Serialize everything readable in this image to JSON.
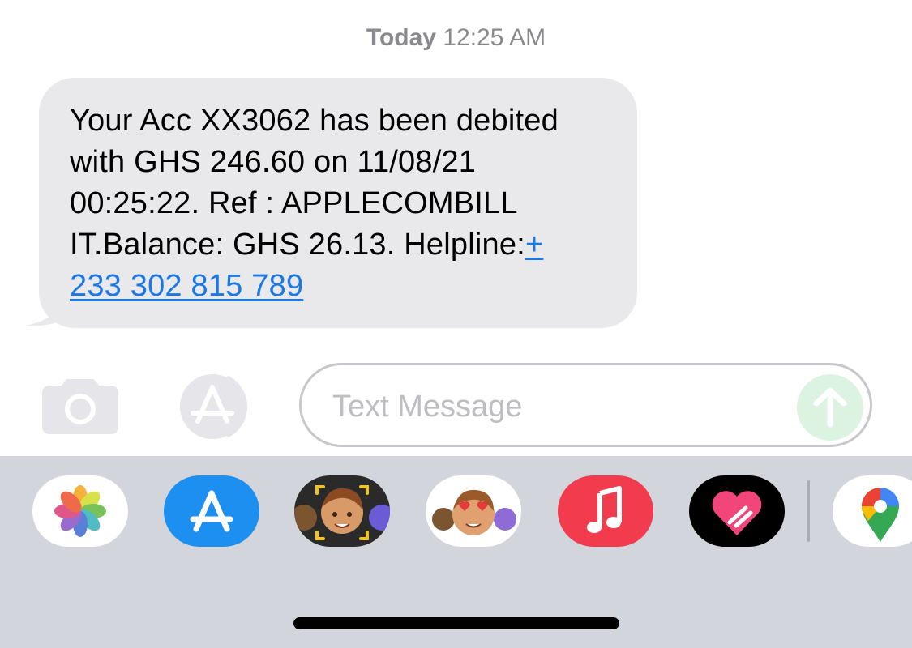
{
  "timestamp": {
    "day": "Today",
    "time": "12:25 AM"
  },
  "message": {
    "line1": "Your Acc XX3062 has been debited",
    "line2": "with GHS 246.60 on 11/08/21",
    "line3": "00:25:22. Ref : APPLECOMBILL",
    "line4_text": "IT.Balance: GHS 26.13. Helpline:",
    "line4_link": "+",
    "line5_link": "233 302 815 789",
    "bubble_color": "#e9e9eb",
    "link_color": "#1b78e6"
  },
  "compose": {
    "placeholder": "Text Message",
    "camera_icon": "camera-icon",
    "appstore_icon": "app-store-icon",
    "send_icon": "arrow-up-icon",
    "send_color": "#ddf3e1"
  },
  "app_drawer": {
    "background": "#d2d5db",
    "apps": [
      {
        "name": "photos-icon"
      },
      {
        "name": "app-store-icon"
      },
      {
        "name": "memoji-camera-icon"
      },
      {
        "name": "memoji-stickers-icon"
      },
      {
        "name": "music-icon"
      },
      {
        "name": "digital-touch-icon"
      },
      {
        "name": "google-maps-icon"
      }
    ]
  }
}
